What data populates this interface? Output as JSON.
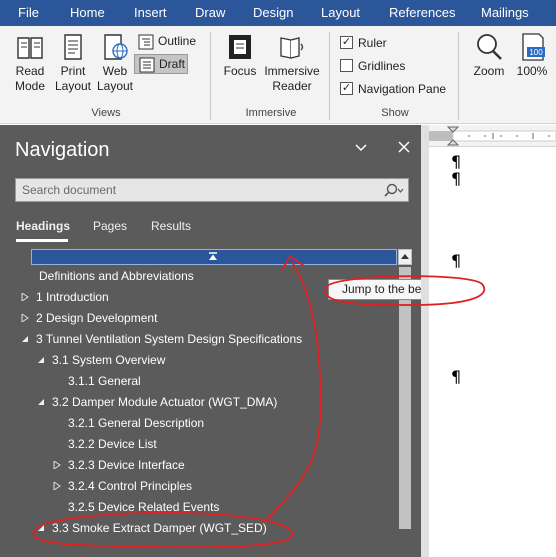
{
  "menu": [
    "File",
    "Home",
    "Insert",
    "Draw",
    "Design",
    "Layout",
    "References",
    "Mailings"
  ],
  "ribbon": {
    "views": {
      "label": "Views",
      "read_mode": [
        "Read",
        "Mode"
      ],
      "print_layout": [
        "Print",
        "Layout"
      ],
      "web_layout": [
        "Web",
        "Layout"
      ],
      "outline": "Outline",
      "draft": "Draft"
    },
    "immersive": {
      "label": "Immersive",
      "focus": "Focus",
      "immersive_reader": [
        "Immersive",
        "Reader"
      ]
    },
    "show": {
      "label": "Show",
      "ruler": "Ruler",
      "ruler_checked": true,
      "gridlines": "Gridlines",
      "gridlines_checked": false,
      "navigation_pane": "Navigation Pane",
      "navigation_pane_checked": true
    },
    "zoom": {
      "zoom": "Zoom",
      "percent": "100%",
      "icon_text": "100"
    }
  },
  "nav": {
    "title": "Navigation",
    "search_placeholder": "Search document",
    "tabs": [
      "Headings",
      "Pages",
      "Results"
    ],
    "tooltip": "Jump to the beginning",
    "tree": [
      {
        "text": "Definitions and Abbreviations",
        "level": 1,
        "state": "none"
      },
      {
        "text": "1 Introduction",
        "level": 1,
        "state": "collapsed"
      },
      {
        "text": "2 Design Development",
        "level": 1,
        "state": "collapsed"
      },
      {
        "text": "3 Tunnel Ventilation System Design Specifications",
        "level": 1,
        "state": "expanded"
      },
      {
        "text": "3.1 System Overview",
        "level": 2,
        "state": "expanded"
      },
      {
        "text": "3.1.1 General",
        "level": 3,
        "state": "none"
      },
      {
        "text": "3.2 Damper Module Actuator (WGT_DMA)",
        "level": 2,
        "state": "expanded"
      },
      {
        "text": "3.2.1 General Description",
        "level": 3,
        "state": "none"
      },
      {
        "text": "3.2.2 Device List",
        "level": 3,
        "state": "none"
      },
      {
        "text": "3.2.3 Device Interface",
        "level": 3,
        "state": "collapsed"
      },
      {
        "text": "3.2.4 Control Principles",
        "level": 3,
        "state": "collapsed"
      },
      {
        "text": "3.2.5 Device Related Events",
        "level": 3,
        "state": "none"
      },
      {
        "text": "3.3 Smoke Extract Damper (WGT_SED)",
        "level": 2,
        "state": "expanded"
      }
    ]
  },
  "document": {
    "pilcrow": "¶"
  },
  "colors": {
    "ribbon_accent": "#2b579a",
    "nav_bg": "#5b5b5b",
    "annotation_red": "#e02020"
  }
}
